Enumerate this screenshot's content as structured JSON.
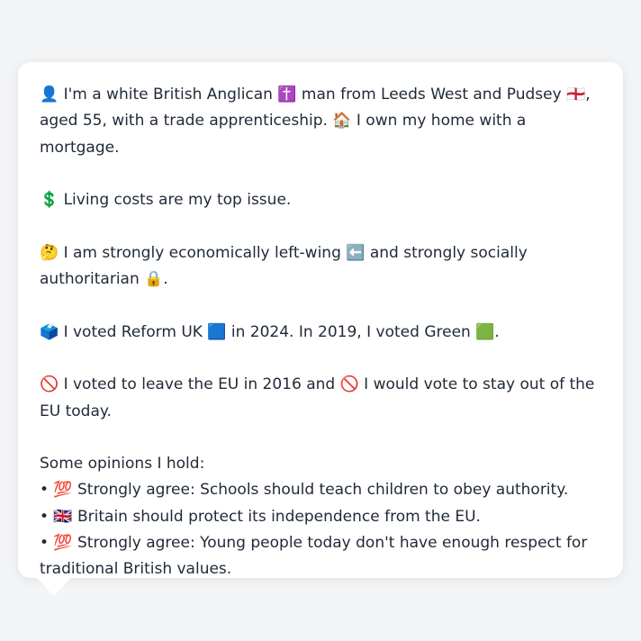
{
  "profile": {
    "line1": "👤 I'm a white British Anglican ✝️ man from Leeds West and Pudsey 🏴󠁧󠁢󠁥󠁮󠁧󠁿, aged 55, with a trade apprenticeship. 🏠 I own my home with a mortgage.",
    "line2": "💲 Living costs are my top issue.",
    "line3": "🤔 I am strongly economically left-wing ⬅️ and strongly socially authoritarian 🔒.",
    "line4": "🗳️ I voted Reform UK 🟦 in 2024. In 2019, I voted Green 🟩.",
    "line5": "🚫 I voted to leave the EU in 2016 and 🚫 I would vote to stay out of the EU today."
  },
  "opinions": {
    "heading": "Some opinions I hold:",
    "items": [
      "• 💯 Strongly agree: Schools should teach children to obey authority.",
      "• 🇬🇧 Britain should protect its independence from the EU.",
      "• 💯 Strongly agree: Young people today don't have enough respect for traditional British values."
    ]
  }
}
